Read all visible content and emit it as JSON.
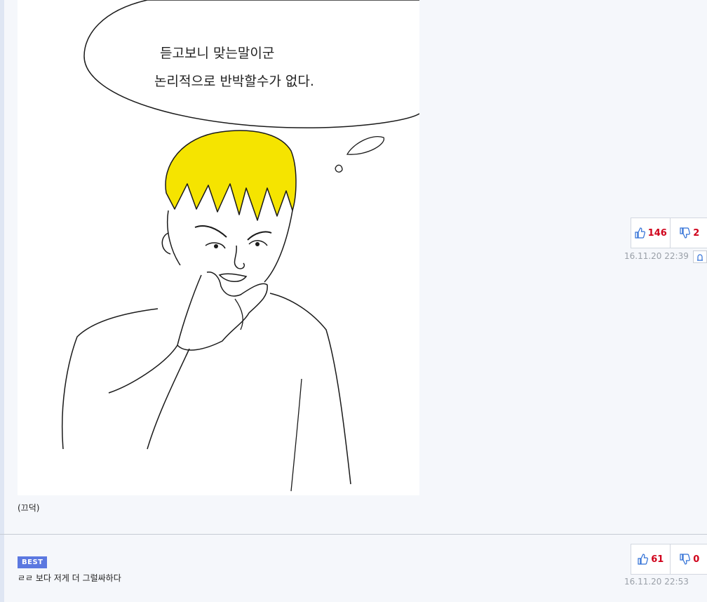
{
  "comment1": {
    "image": {
      "speech_line1": "듣고보니 맞는말이군",
      "speech_line2": "논리적으로 반박할수가 없다."
    },
    "caption": "(끄덕)",
    "upvotes": "146",
    "downvotes": "2",
    "timestamp": "16.11.20 22:39"
  },
  "comment2": {
    "badge": "BEST",
    "text": "ㄹㄹ 보다 저게 더 그럴싸하다",
    "upvotes": "61",
    "downvotes": "0",
    "timestamp": "16.11.20 22:53"
  },
  "colors": {
    "hair": "#f5e400",
    "vote_count": "#d0021b",
    "thumb_icon": "#2f6fd6",
    "best_badge": "#5b78e0"
  }
}
